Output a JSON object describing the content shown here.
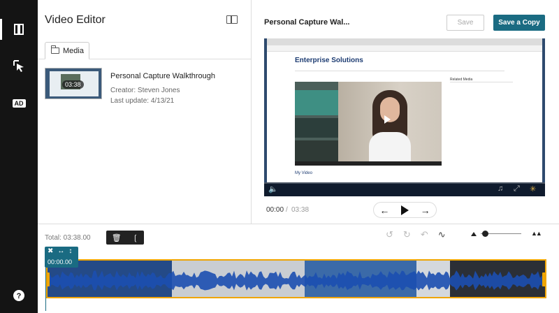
{
  "editor": {
    "title": "Video Editor",
    "media_tab_label": "Media"
  },
  "media_item": {
    "name": "Personal Capture Walkthrough",
    "creator": "Creator: Steven Jones",
    "last_update": "Last update: 4/13/21",
    "duration": "03:38"
  },
  "preview": {
    "title": "Personal Capture Wal...",
    "save_label": "Save",
    "save_copy_label": "Save a Copy",
    "current_time": "00:00",
    "separator": "/",
    "total_time": "03:38",
    "colors": {
      "accent": "#1a6b82",
      "track_border": "#f0a500"
    }
  },
  "player_content": {
    "site_title": "Enterprise Solutions",
    "related_media": "Related Media",
    "my_video": "My Video"
  },
  "timeline": {
    "total_label": "Total: 03:38.00",
    "playhead_time": "00:00.00"
  },
  "icons": {
    "rail": [
      "scenes-icon",
      "cursor-select-icon",
      "audio-description-icon",
      "help-icon"
    ],
    "ad_label": "AD",
    "help_glyph": "?"
  }
}
